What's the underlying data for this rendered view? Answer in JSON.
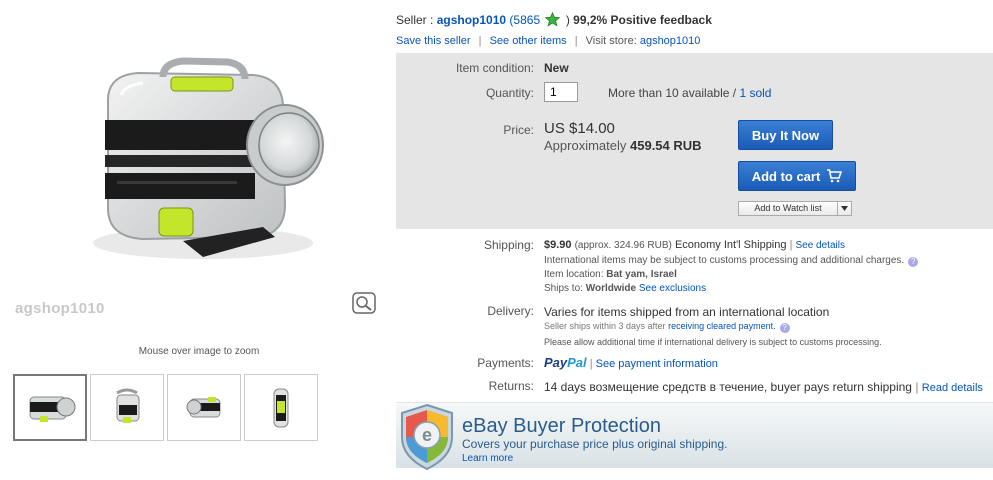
{
  "gallery": {
    "watermark": "agshop1010",
    "zoom_hint": "Mouse over image to zoom",
    "thumbnails": [
      "thumbnail-1",
      "thumbnail-2",
      "thumbnail-3",
      "thumbnail-4"
    ],
    "selected_index": 0
  },
  "seller": {
    "label": "Seller :",
    "name": "agshop1010",
    "score_open": "(5865",
    "score_close": ")",
    "positive_feedback": "99,2% Positive feedback",
    "save_link": "Save this seller",
    "other_items_link": "See other items",
    "visit_store_label": "Visit store:",
    "store_link": "agshop1010"
  },
  "buy_box": {
    "condition_label": "Item condition:",
    "condition_value": "New",
    "quantity_label": "Quantity:",
    "quantity_value": "1",
    "availability": "More than 10 available /",
    "sold_link": "1 sold",
    "price_label": "Price:",
    "price_value": "US $14.00",
    "approx_label": "Approximately",
    "approx_value": "459.54 RUB",
    "buy_now": "Buy It Now",
    "add_to_cart": "Add to cart",
    "watch_list": "Add to Watch list"
  },
  "shipping": {
    "label": "Shipping:",
    "cost": "$9.90",
    "approx": "(approx. 324.96 RUB)",
    "service": "Economy Int'l Shipping",
    "details_link": "See details",
    "customs_note": "International items may be subject to customs processing and additional charges.",
    "location_label": "Item location:",
    "location_value": "Bat yam, Israel",
    "ships_to_label": "Ships to:",
    "ships_to_value": "Worldwide",
    "exclusions_link": "See exclusions"
  },
  "delivery": {
    "label": "Delivery:",
    "value": "Varies for items shipped from an international location",
    "ships_within": "Seller ships within 3 days after",
    "cleared_link": "receiving cleared payment.",
    "allow_note": "Please allow additional time if international delivery is subject to customs processing."
  },
  "payments": {
    "label": "Payments:",
    "paypal_1": "Pay",
    "paypal_2": "Pal",
    "info_link": "See payment information"
  },
  "returns": {
    "label": "Returns:",
    "value": "14 days возмещение средств в течение, buyer pays return shipping",
    "details_link": "Read details"
  },
  "protection": {
    "title": "eBay Buyer Protection",
    "subtitle": "Covers your purchase price plus original shipping.",
    "learn_more": "Learn more"
  },
  "colors": {
    "link": "#0654ba",
    "button_blue": "#1a5bb6",
    "buy_box_bg": "#e5e5e5",
    "product_green": "#c4e62a",
    "protection_text": "#2a5b8d"
  },
  "icons": {
    "star": "green-star-icon",
    "cart": "cart-icon",
    "info": "info-icon",
    "shield": "ebay-shield-icon"
  }
}
